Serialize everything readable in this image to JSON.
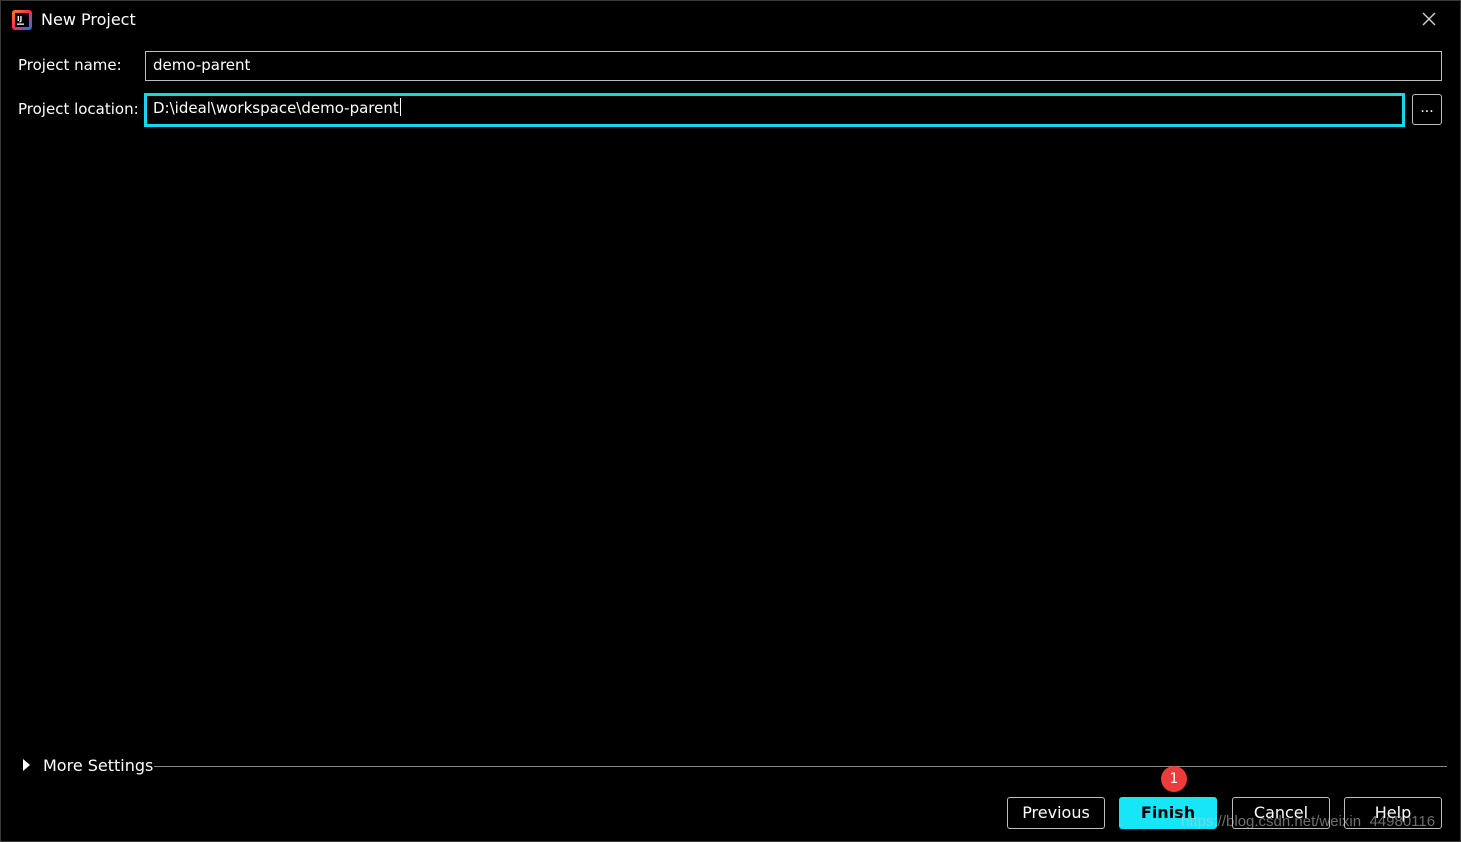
{
  "window": {
    "title": "New Project",
    "icon": "intellij-app-icon",
    "close_icon": "close-icon"
  },
  "form": {
    "name_label": "Project name:",
    "name_value": "demo-parent",
    "location_label": "Project location:",
    "location_value": "D:\\ideal\\workspace\\demo-parent",
    "browse_label": "..."
  },
  "more_settings": {
    "label": "More Settings"
  },
  "buttons": {
    "previous": "Previous",
    "finish": "Finish",
    "cancel": "Cancel",
    "help": "Help"
  },
  "annotation": {
    "badge": "1"
  },
  "watermark": "https://blog.csdn.net/weixin_44980116",
  "colors": {
    "accent": "#16e6f7",
    "focus_border": "#17d7ec",
    "badge": "#ee3b3b",
    "background": "#000000"
  }
}
